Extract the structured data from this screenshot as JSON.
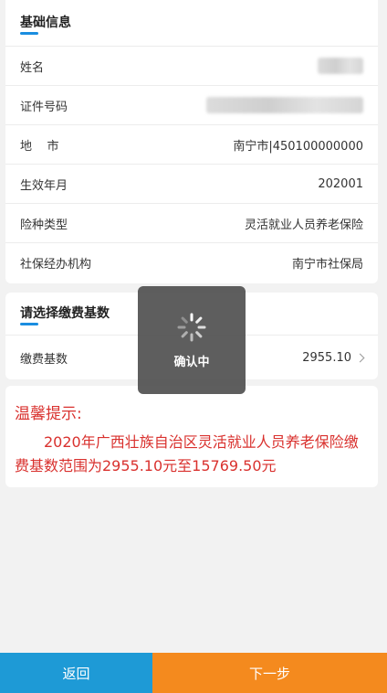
{
  "basic_info": {
    "title": "基础信息",
    "rows": [
      {
        "label": "姓名",
        "value": ""
      },
      {
        "label": "证件号码",
        "value": ""
      },
      {
        "label": "地    市",
        "value": "南宁市|450100000000"
      },
      {
        "label": "生效年月",
        "value": "202001"
      },
      {
        "label": "险种类型",
        "value": "灵活就业人员养老保险"
      },
      {
        "label": "社保经办机构",
        "value": "南宁市社保局"
      }
    ]
  },
  "base_select": {
    "title": "请选择缴费基数",
    "label": "缴费基数",
    "value": "2955.10"
  },
  "tip": {
    "title": "温馨提示:",
    "body": "2020年广西壮族自治区灵活就业人员养老保险缴费基数范围为2955.10元至15769.50元"
  },
  "loading": {
    "text": "确认中",
    "icon": "spinner-icon"
  },
  "bottom": {
    "back_label": "返回",
    "next_label": "下一步"
  },
  "colors": {
    "accent_blue": "#1a8de0",
    "back_button": "#1e9ad6",
    "next_button": "#f48a1e",
    "tip_red": "#d9312e"
  }
}
